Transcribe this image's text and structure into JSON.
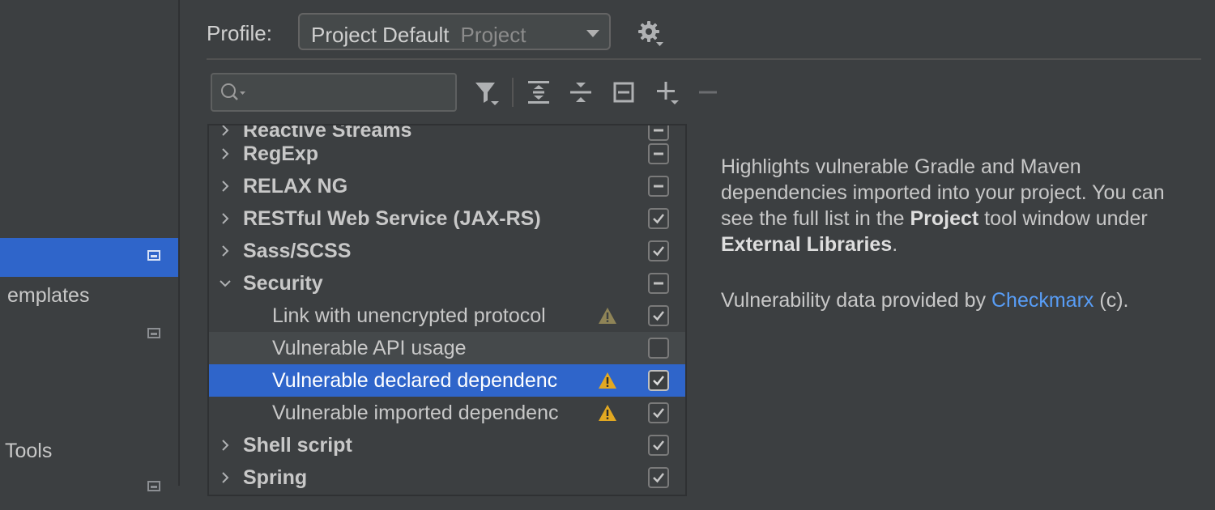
{
  "sidebar": {
    "items": [
      {
        "label": "",
        "selected": true
      },
      {
        "label": "emplates",
        "selected": false
      },
      {
        "label": "",
        "selected": false
      },
      {
        "label": "Tools",
        "selected": false
      }
    ]
  },
  "profile": {
    "label": "Profile:",
    "name": "Project Default",
    "scope": "Project"
  },
  "search": {
    "placeholder": "",
    "value": ""
  },
  "tree": {
    "rows": [
      {
        "label": "Reactive Streams",
        "type": "group",
        "expanded": false,
        "check": "mixed"
      },
      {
        "label": "RegExp",
        "type": "group",
        "expanded": false,
        "check": "mixed"
      },
      {
        "label": "RELAX NG",
        "type": "group",
        "expanded": false,
        "check": "mixed"
      },
      {
        "label": "RESTful Web Service (JAX-RS)",
        "type": "group",
        "expanded": false,
        "check": "checked"
      },
      {
        "label": "Sass/SCSS",
        "type": "group",
        "expanded": false,
        "check": "checked"
      },
      {
        "label": "Security",
        "type": "group",
        "expanded": true,
        "check": "mixed"
      },
      {
        "label": "Link with unencrypted protocol",
        "type": "item",
        "severity": "weak-warning",
        "check": "checked"
      },
      {
        "label": "Vulnerable API usage",
        "type": "item",
        "severity": "",
        "check": "unchecked"
      },
      {
        "label": "Vulnerable declared dependenc",
        "type": "item",
        "severity": "warning",
        "check": "checked",
        "selected": true
      },
      {
        "label": "Vulnerable imported dependenc",
        "type": "item",
        "severity": "warning",
        "check": "checked"
      },
      {
        "label": "Shell script",
        "type": "group",
        "expanded": false,
        "check": "checked"
      },
      {
        "label": "Spring",
        "type": "group",
        "expanded": false,
        "check": "checked"
      }
    ]
  },
  "description": {
    "p1_a": "Highlights vulnerable Gradle and Maven dependencies imported into your project. You can see the full list in the ",
    "p1_b": "Project",
    "p1_c": " tool window under ",
    "p1_d": "External Libraries",
    "p1_e": ".",
    "p2_a": "Vulnerability data provided by ",
    "p2_link": "Checkmarx",
    "p2_b": " (c)."
  },
  "colors": {
    "background": "#3c3f41",
    "selection": "#2f65ca",
    "link": "#589df6",
    "warning": "#e2a821",
    "weak_warning": "#8f8457"
  },
  "icons": [
    "gear-icon",
    "search-icon",
    "filter-icon",
    "expand-all-icon",
    "collapse-all-icon",
    "reset-icon",
    "add-icon",
    "remove-icon",
    "warning-icon"
  ]
}
